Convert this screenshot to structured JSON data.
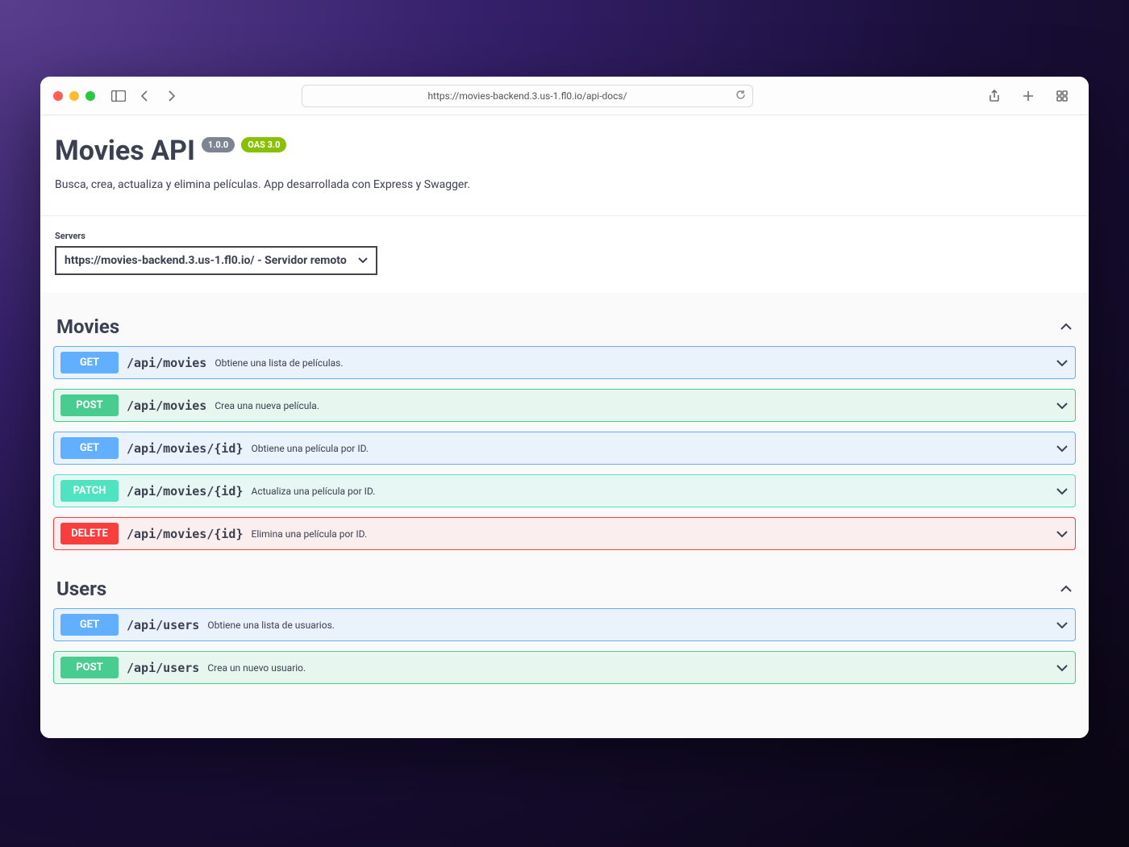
{
  "browser": {
    "url": "https://movies-backend.3.us-1.fl0.io/api-docs/"
  },
  "header": {
    "title": "Movies API",
    "version": "1.0.0",
    "oas": "OAS 3.0",
    "description": "Busca, crea, actualiza y elimina películas. App desarrollada con Express y Swagger."
  },
  "servers": {
    "label": "Servers",
    "selected": "https://movies-backend.3.us-1.fl0.io/ - Servidor remoto"
  },
  "tags": [
    {
      "name": "Movies",
      "ops": [
        {
          "method": "GET",
          "path": "/api/movies",
          "summary": "Obtiene una lista de películas."
        },
        {
          "method": "POST",
          "path": "/api/movies",
          "summary": "Crea una nueva película."
        },
        {
          "method": "GET",
          "path": "/api/movies/{id}",
          "summary": "Obtiene una película por ID."
        },
        {
          "method": "PATCH",
          "path": "/api/movies/{id}",
          "summary": "Actualiza una película por ID."
        },
        {
          "method": "DELETE",
          "path": "/api/movies/{id}",
          "summary": "Elimina una película por ID."
        }
      ]
    },
    {
      "name": "Users",
      "ops": [
        {
          "method": "GET",
          "path": "/api/users",
          "summary": "Obtiene una lista de usuarios."
        },
        {
          "method": "POST",
          "path": "/api/users",
          "summary": "Crea un nuevo usuario."
        }
      ]
    }
  ]
}
